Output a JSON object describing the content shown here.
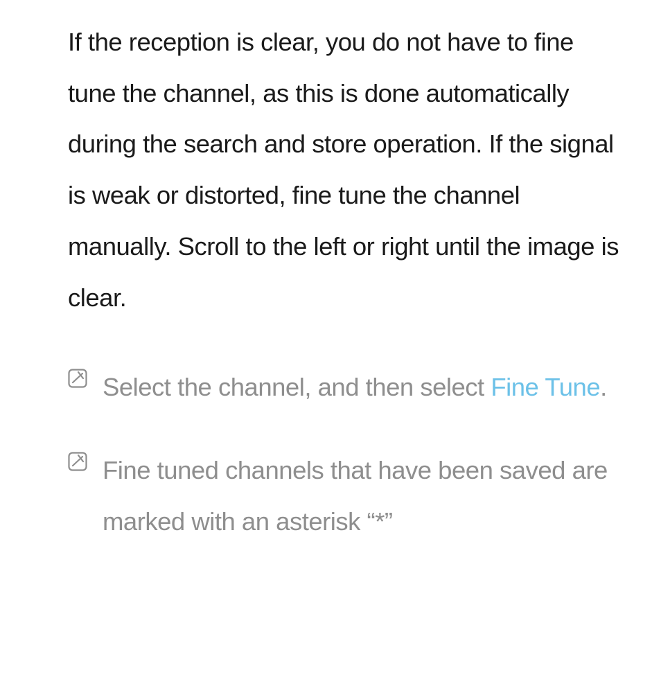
{
  "main_paragraph": "If the reception is clear, you do not have to fine tune the channel, as this is done automatically during the search and store operation. If the signal is weak or distorted, fine tune the channel manually. Scroll to the left or right until the image is clear.",
  "notes": [
    {
      "prefix": "Select the channel, and then select ",
      "highlight": "Fine Tune",
      "suffix": "."
    },
    {
      "prefix": "Fine tuned channels that have been saved are marked with an asterisk “*”",
      "highlight": "",
      "suffix": ""
    }
  ]
}
